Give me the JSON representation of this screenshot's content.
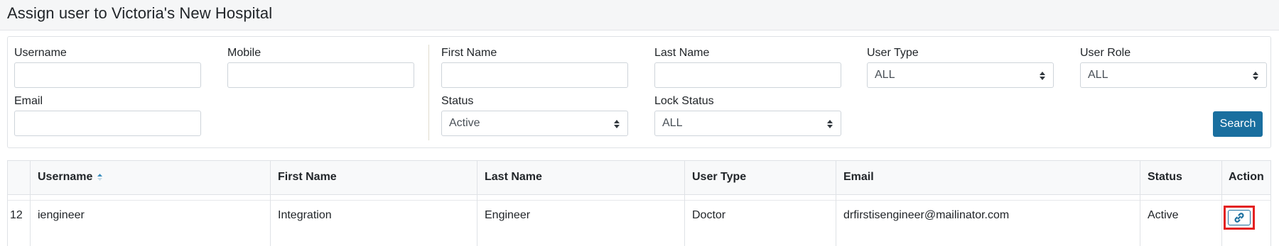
{
  "page": {
    "title": "Assign user to Victoria's New Hospital"
  },
  "filters": {
    "username_label": "Username",
    "mobile_label": "Mobile",
    "email_label": "Email",
    "first_name_label": "First Name",
    "last_name_label": "Last Name",
    "status_label": "Status",
    "status_value": "Active",
    "lock_status_label": "Lock Status",
    "lock_status_value": "ALL",
    "user_type_label": "User Type",
    "user_type_value": "ALL",
    "user_role_label": "User Role",
    "user_role_value": "ALL",
    "search_button": "Search"
  },
  "table": {
    "columns": [
      "Username",
      "First Name",
      "Last Name",
      "User Type",
      "Email",
      "Status",
      "Action"
    ],
    "sorted_column": "Username",
    "rows": [
      {
        "row_number": "12",
        "username": "iengineer",
        "first_name": "Integration",
        "last_name": "Engineer",
        "user_type": "Doctor",
        "email": "drfirstisengineer@mailinator.com",
        "status": "Active",
        "action_icon": "link-icon"
      }
    ]
  },
  "colors": {
    "primary_button": "#1a6f9f",
    "highlight_border": "#e32121",
    "sort_icon": "#3a8dbd"
  }
}
